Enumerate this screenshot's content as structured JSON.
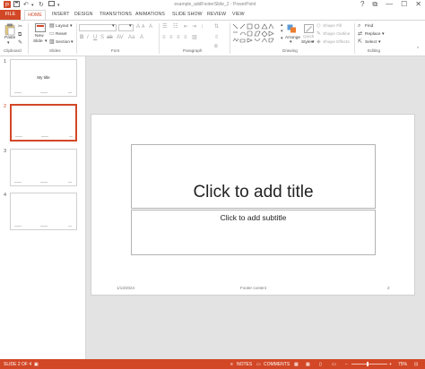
{
  "window": {
    "title": "example_addFooterSlide_2 - PowerPoint",
    "controls": [
      "?",
      "⧉",
      "—",
      "☐",
      "✕"
    ]
  },
  "tabs": {
    "file": "FILE",
    "items": [
      "HOME",
      "INSERT",
      "DESIGN",
      "TRANSITIONS",
      "ANIMATIONS",
      "SLIDE SHOW",
      "REVIEW",
      "VIEW"
    ]
  },
  "ribbon": {
    "clipboard": {
      "paste": "Paste",
      "label": "Clipboard"
    },
    "slides": {
      "new_slide": "New",
      "new_slide2": "Slide",
      "layout": "Layout",
      "reset": "Reset",
      "section": "Section",
      "label": "Slides"
    },
    "font": {
      "label": "Font"
    },
    "paragraph": {
      "label": "Paragraph"
    },
    "drawing": {
      "arrange": "Arrange",
      "quick_styles": "Quick",
      "quick_styles2": "Styles",
      "shape_fill": "Shape Fill",
      "shape_outline": "Shape Outline",
      "shape_effects": "Shape Effects",
      "label": "Drawing"
    },
    "editing": {
      "find": "Find",
      "replace": "Replace",
      "select": "Select",
      "label": "Editing"
    }
  },
  "thumbnails": [
    {
      "num": "1",
      "title": "My title"
    },
    {
      "num": "2",
      "title": ""
    },
    {
      "num": "3",
      "title": ""
    },
    {
      "num": "4",
      "title": ""
    }
  ],
  "slide": {
    "title_placeholder": "Click to add title",
    "subtitle_placeholder": "Click to add subtitle",
    "footer_date": "1/13/2024",
    "footer_text": "Footer content",
    "footer_num": "2"
  },
  "status": {
    "slide_info": "SLIDE 2 OF 4",
    "notes": "NOTES",
    "comments": "COMMENTS",
    "zoom": "75%"
  },
  "colors": {
    "accent": "#d24726"
  }
}
